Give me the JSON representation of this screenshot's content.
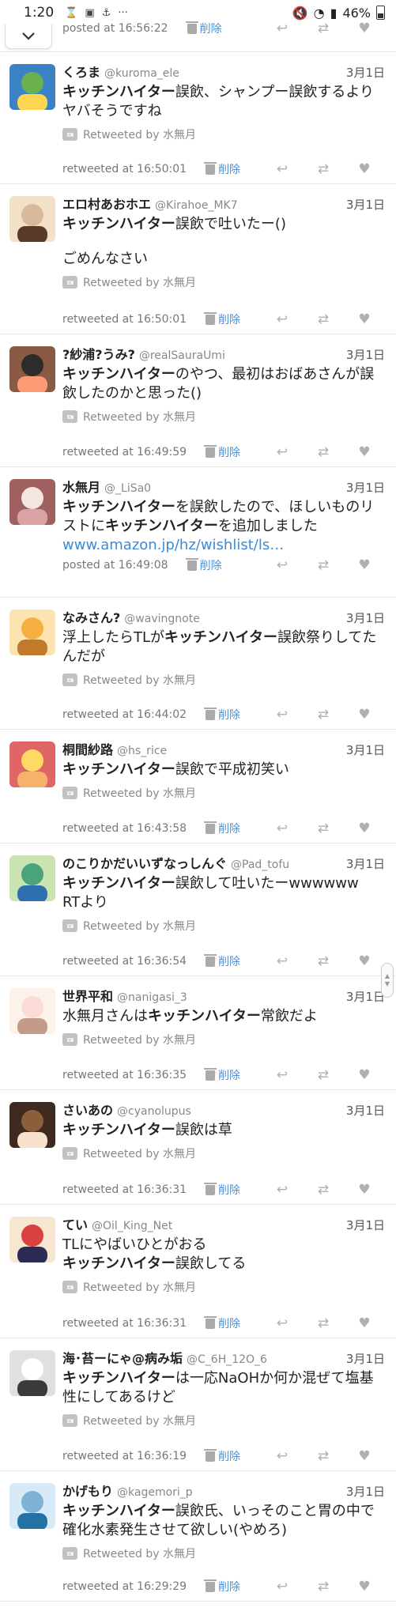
{
  "status_bar": {
    "time": "1:20",
    "dots": "···",
    "battery": "46%"
  },
  "colors": {
    "link": "#3b8ad9",
    "delete": "#4a90d9",
    "muted": "#888888",
    "action_icons": "#b0b0b0"
  },
  "tweets": [
    {
      "name": "",
      "handle": "",
      "date": "",
      "text": [],
      "rt_by": "",
      "footer_label": "posted at 16:56:22",
      "delete_label": "削除"
    },
    {
      "name": "くろま",
      "handle": "@kuroma_ele",
      "date": "3月1日",
      "text": [
        [
          "キッチンハイター",
          "誤飲、シャンプー誤飲するよりヤバそうですね"
        ]
      ],
      "rt_by": "Retweeted by 水無月",
      "footer_label": "retweeted at 16:50:01",
      "delete_label": "削除"
    },
    {
      "name": "エロ村あおホエ",
      "handle": "@Kirahoe_MK7",
      "date": "3月1日",
      "text": [
        [
          "キッチンハイター",
          "誤飲で吐いたー()"
        ],
        [
          "",
          "ごめんなさい"
        ]
      ],
      "rt_by": "Retweeted by 水無月",
      "footer_label": "retweeted at 16:50:01",
      "delete_label": "削除"
    },
    {
      "name": "?紗浦?うみ?",
      "handle": "@realSauraUmi",
      "date": "3月1日",
      "text": [
        [
          "キッチンハイター",
          "のやつ、最初はおばあさんが誤飲したのかと思った()"
        ]
      ],
      "rt_by": "Retweeted by 水無月",
      "footer_label": "retweeted at 16:49:59",
      "delete_label": "削除"
    },
    {
      "name": "水無月",
      "handle": "@_LiSa0",
      "date": "3月1日",
      "text": [
        [
          "",
          "を誤飲したので、ほしいものリストに"
        ]
      ],
      "rich": [
        "キッチンハイター",
        "を誤飲したので、ほしいものリストに",
        "キッチンハイター",
        "を追加しました"
      ],
      "link": "www.amazon.jp/hz/wishlist/ls…",
      "rt_by": "",
      "footer_label": "posted at 16:49:08",
      "delete_label": "削除"
    },
    {
      "name": "なみさん?",
      "handle": "@wavingnote",
      "date": "3月1日",
      "text": [],
      "rich2": [
        "浮上したらTLが",
        "キッチンハイター",
        "誤飲祭りしてたんだが"
      ],
      "rt_by": "Retweeted by 水無月",
      "footer_label": "retweeted at 16:44:02",
      "delete_label": "削除"
    },
    {
      "name": "桐間紗路",
      "handle": "@hs_rice",
      "date": "3月1日",
      "text": [
        [
          "キッチンハイター",
          "誤飲で平成初笑い"
        ]
      ],
      "rt_by": "Retweeted by 水無月",
      "footer_label": "retweeted at 16:43:58",
      "delete_label": "削除"
    },
    {
      "name": "のこりかだいいずなっしんぐ",
      "handle": "@Pad_tofu",
      "date": "3月1日",
      "text": [
        [
          "キッチンハイター",
          "誤飲して吐いたーwwwwww"
        ],
        [
          "",
          "RTより"
        ]
      ],
      "rt_by": "Retweeted by 水無月",
      "footer_label": "retweeted at 16:36:54",
      "delete_label": "削除"
    },
    {
      "name": "世界平和",
      "handle": "@nanigasi_3",
      "date": "3月1日",
      "text": [],
      "rich2": [
        "水無月さんは",
        "キッチンハイター",
        "常飲だよ"
      ],
      "rt_by": "Retweeted by 水無月",
      "footer_label": "retweeted at 16:36:35",
      "delete_label": "削除"
    },
    {
      "name": "さいあの",
      "handle": "@cyanolupus",
      "date": "3月1日",
      "text": [
        [
          "キッチンハイター",
          "誤飲は草"
        ]
      ],
      "rt_by": "Retweeted by 水無月",
      "footer_label": "retweeted at 16:36:31",
      "delete_label": "削除"
    },
    {
      "name": "てい",
      "handle": "@Oil_King_Net",
      "date": "3月1日",
      "text": [
        [
          "",
          "TLにやばいひとがおる"
        ],
        [
          "キッチンハイター",
          "誤飲してる"
        ]
      ],
      "rt_by": "Retweeted by 水無月",
      "footer_label": "retweeted at 16:36:31",
      "delete_label": "削除"
    },
    {
      "name": "海･苔ーにゃ@病み垢",
      "handle": "@C_6H_12O_6",
      "date": "3月1日",
      "text": [
        [
          "キッチンハイター",
          "は一応NaOHか何か混ぜて塩基性にしてあるけど"
        ]
      ],
      "rt_by": "Retweeted by 水無月",
      "footer_label": "retweeted at 16:36:19",
      "delete_label": "削除"
    },
    {
      "name": "かげもり",
      "handle": "@kagemori_p",
      "date": "3月1日",
      "text": [
        [
          "キッチンハイター",
          "誤飲氏、いっそのこと胃の中で確化水素発生させて欲しい(やめろ)"
        ]
      ],
      "rt_by": "Retweeted by 水無月",
      "footer_label": "retweeted at 16:29:29",
      "delete_label": "削除"
    }
  ]
}
